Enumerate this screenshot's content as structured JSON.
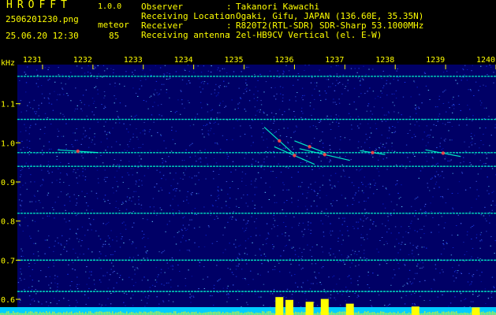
{
  "header": {
    "app_title": "HROFFT",
    "app_version": "1.0.0",
    "file_name": "2506201230.png",
    "mode_label": "meteor",
    "timestamp": "25.06.20 12:30",
    "count_value": "85",
    "meta": [
      {
        "key": "Observer",
        "value": "Takanori Kawachi"
      },
      {
        "key": "Receiving Location",
        "value": "Ogaki, Gifu, JAPAN (136.60E, 35.35N)"
      },
      {
        "key": "Receiver",
        "value": "R820T2(RTL-SDR) SDR-Sharp 53.1000MHz"
      },
      {
        "key": "Receiving antenna",
        "value": "2el-HB9CV Vertical (el. E-W)"
      }
    ],
    "separator": ":"
  },
  "colors": {
    "text": "#ffff00",
    "background_noise": "#00008b",
    "carrier": "#00ffcc",
    "echo": "#ff4040",
    "baseline": "#00ccff"
  },
  "chart_data": {
    "type": "heatmap",
    "ylabel": "kHz",
    "ylim": [
      0.58,
      1.2
    ],
    "yticks": [
      {
        "value": 1.1,
        "label": "1.1"
      },
      {
        "value": 1.0,
        "label": "1.0"
      },
      {
        "value": 0.9,
        "label": "0.9"
      },
      {
        "value": 0.8,
        "label": "0.8"
      },
      {
        "value": 0.7,
        "label": "0.7"
      },
      {
        "value": 0.6,
        "label": "0.6"
      }
    ],
    "xlim": [
      1230.5,
      1240
    ],
    "xticks": [
      {
        "value": 1231,
        "label": "1231"
      },
      {
        "value": 1232,
        "label": "1232"
      },
      {
        "value": 1233,
        "label": "1233"
      },
      {
        "value": 1234,
        "label": "1234"
      },
      {
        "value": 1235,
        "label": "1235"
      },
      {
        "value": 1236,
        "label": "1236"
      },
      {
        "value": 1237,
        "label": "1237"
      },
      {
        "value": 1238,
        "label": "1238"
      },
      {
        "value": 1239,
        "label": "1239"
      },
      {
        "value": 1240,
        "label": "1240"
      }
    ],
    "carriers": [
      {
        "freq": 1.17,
        "x_start": 1230.5,
        "x_end": 1240
      },
      {
        "freq": 1.06,
        "x_start": 1230.5,
        "x_end": 1240
      },
      {
        "freq": 0.975,
        "x_start": 1230.5,
        "x_end": 1240
      },
      {
        "freq": 0.94,
        "x_start": 1230.5,
        "x_end": 1240
      },
      {
        "freq": 0.82,
        "x_start": 1230.5,
        "x_end": 1240
      },
      {
        "freq": 0.7,
        "x_start": 1230.5,
        "x_end": 1240
      },
      {
        "freq": 0.62,
        "x_start": 1230.5,
        "x_end": 1240
      }
    ],
    "echoes": [
      {
        "x_start": 1231.3,
        "x_end": 1232.1,
        "freq_start": 0.982,
        "freq_end": 0.975
      },
      {
        "x_start": 1235.4,
        "x_end": 1236.0,
        "freq_start": 1.04,
        "freq_end": 0.97
      },
      {
        "x_start": 1235.6,
        "x_end": 1236.4,
        "freq_start": 0.99,
        "freq_end": 0.945
      },
      {
        "x_start": 1236.1,
        "x_end": 1237.1,
        "freq_start": 0.985,
        "freq_end": 0.955
      },
      {
        "x_start": 1236.0,
        "x_end": 1236.6,
        "freq_start": 1.005,
        "freq_end": 0.975
      },
      {
        "x_start": 1237.3,
        "x_end": 1237.8,
        "freq_start": 0.98,
        "freq_end": 0.97
      },
      {
        "x_start": 1238.6,
        "x_end": 1239.3,
        "freq_start": 0.982,
        "freq_end": 0.965
      }
    ],
    "activity_peaks": [
      {
        "x": 1235.7,
        "level": 0.95
      },
      {
        "x": 1235.9,
        "level": 0.8
      },
      {
        "x": 1236.3,
        "level": 0.7
      },
      {
        "x": 1236.6,
        "level": 0.85
      },
      {
        "x": 1237.1,
        "level": 0.6
      },
      {
        "x": 1238.4,
        "level": 0.45
      },
      {
        "x": 1239.6,
        "level": 0.4
      }
    ]
  }
}
